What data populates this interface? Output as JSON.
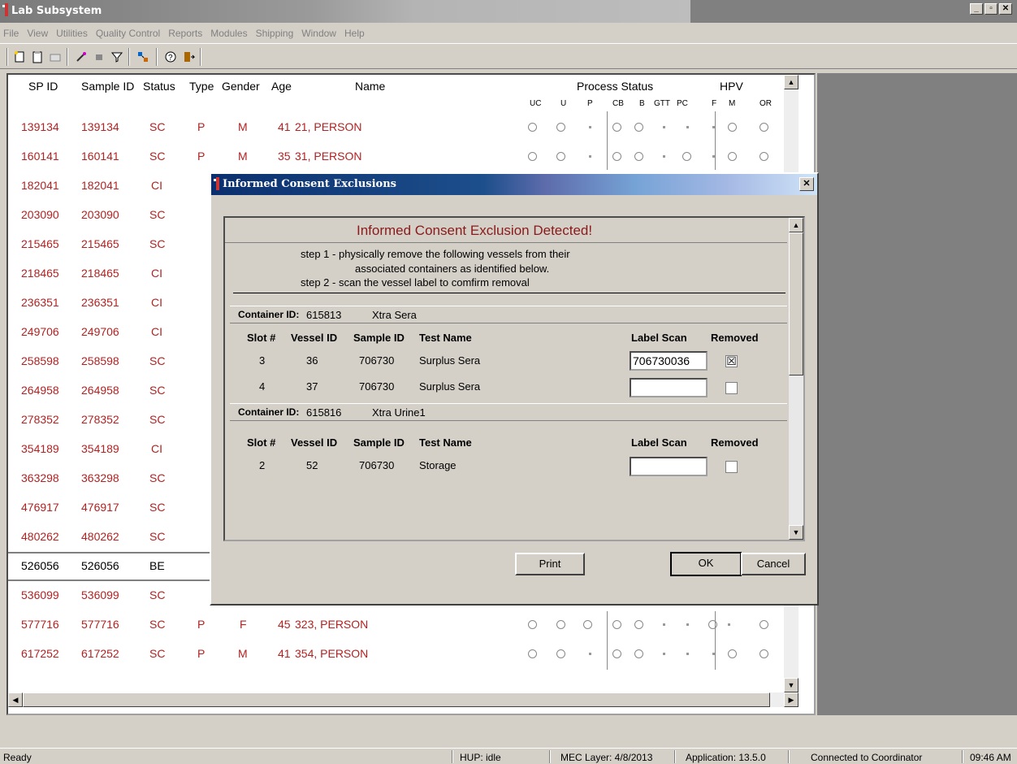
{
  "app": {
    "title": "Lab Subsystem"
  },
  "menu": [
    "File",
    "View",
    "Utilities",
    "Quality Control",
    "Reports",
    "Modules",
    "Shipping",
    "Window",
    "Help"
  ],
  "table": {
    "headers": {
      "spid": "SP ID",
      "sampleid": "Sample ID",
      "status": "Status",
      "type": "Type",
      "gender": "Gender",
      "age": "Age",
      "name": "Name",
      "process": "Process Status",
      "hpv": "HPV"
    },
    "sub": [
      "UC",
      "U",
      "P",
      "CB",
      "B",
      "GTT",
      "PC",
      "F",
      "M",
      "OR"
    ],
    "rows": [
      {
        "spid": "139134",
        "sid": "139134",
        "status": "SC",
        "type": "P",
        "gender": "M",
        "age": "41",
        "name": "21, PERSON"
      },
      {
        "spid": "160141",
        "sid": "160141",
        "status": "SC",
        "type": "P",
        "gender": "M",
        "age": "35",
        "name": "31, PERSON"
      },
      {
        "spid": "182041",
        "sid": "182041",
        "status": "CI",
        "type": "",
        "gender": "",
        "age": "",
        "name": ""
      },
      {
        "spid": "203090",
        "sid": "203090",
        "status": "SC",
        "type": "",
        "gender": "",
        "age": "",
        "name": ""
      },
      {
        "spid": "215465",
        "sid": "215465",
        "status": "SC",
        "type": "",
        "gender": "",
        "age": "",
        "name": ""
      },
      {
        "spid": "218465",
        "sid": "218465",
        "status": "CI",
        "type": "",
        "gender": "",
        "age": "",
        "name": ""
      },
      {
        "spid": "236351",
        "sid": "236351",
        "status": "CI",
        "type": "",
        "gender": "",
        "age": "",
        "name": ""
      },
      {
        "spid": "249706",
        "sid": "249706",
        "status": "CI",
        "type": "",
        "gender": "",
        "age": "",
        "name": ""
      },
      {
        "spid": "258598",
        "sid": "258598",
        "status": "SC",
        "type": "",
        "gender": "",
        "age": "",
        "name": ""
      },
      {
        "spid": "264958",
        "sid": "264958",
        "status": "SC",
        "type": "",
        "gender": "",
        "age": "",
        "name": ""
      },
      {
        "spid": "278352",
        "sid": "278352",
        "status": "SC",
        "type": "",
        "gender": "",
        "age": "",
        "name": ""
      },
      {
        "spid": "354189",
        "sid": "354189",
        "status": "CI",
        "type": "",
        "gender": "",
        "age": "",
        "name": ""
      },
      {
        "spid": "363298",
        "sid": "363298",
        "status": "SC",
        "type": "",
        "gender": "",
        "age": "",
        "name": ""
      },
      {
        "spid": "476917",
        "sid": "476917",
        "status": "SC",
        "type": "",
        "gender": "",
        "age": "",
        "name": ""
      },
      {
        "spid": "480262",
        "sid": "480262",
        "status": "SC",
        "type": "",
        "gender": "",
        "age": "",
        "name": ""
      },
      {
        "spid": "526056",
        "sid": "526056",
        "status": "BE",
        "type": "",
        "gender": "",
        "age": "",
        "name": ""
      },
      {
        "spid": "536099",
        "sid": "536099",
        "status": "SC",
        "type": "",
        "gender": "",
        "age": "",
        "name": ""
      },
      {
        "spid": "577716",
        "sid": "577716",
        "status": "SC",
        "type": "P",
        "gender": "F",
        "age": "45",
        "name": "323, PERSON"
      },
      {
        "spid": "617252",
        "sid": "617252",
        "status": "SC",
        "type": "P",
        "gender": "M",
        "age": "41",
        "name": "354, PERSON"
      }
    ]
  },
  "dialog": {
    "title": "Informed Consent Exclusions",
    "heading": "Informed Consent Exclusion Detected!",
    "step1a": "step 1 -  physically remove the following vessels from their",
    "step1b": "associated containers as identified below.",
    "step2": "step 2 -  scan the vessel label to comfirm removal",
    "c1_label": "Container ID:",
    "c1_id": "615813",
    "c1_name": "Xtra Sera",
    "c2_label": "Container ID:",
    "c2_id": "615816",
    "c2_name": "Xtra Urine1",
    "cols": {
      "slot": "Slot #",
      "vessel": "Vessel ID",
      "sample": "Sample ID",
      "test": "Test Name",
      "scan": "Label Scan",
      "removed": "Removed"
    },
    "r1": {
      "slot": "3",
      "vessel": "36",
      "sample": "706730",
      "test": "Surplus Sera",
      "scan": "706730036"
    },
    "r2": {
      "slot": "4",
      "vessel": "37",
      "sample": "706730",
      "test": "Surplus Sera",
      "scan": ""
    },
    "r3": {
      "slot": "2",
      "vessel": "52",
      "sample": "706730",
      "test": "Storage",
      "scan": ""
    },
    "print": "Print",
    "ok": "OK",
    "cancel": "Cancel"
  },
  "status": {
    "ready": "Ready",
    "hup": "HUP: idle",
    "mec": "MEC Layer: 4/8/2013",
    "app": "Application: 13.5.0",
    "conn": "Connected to Coordinator",
    "time": "09:46 AM"
  }
}
